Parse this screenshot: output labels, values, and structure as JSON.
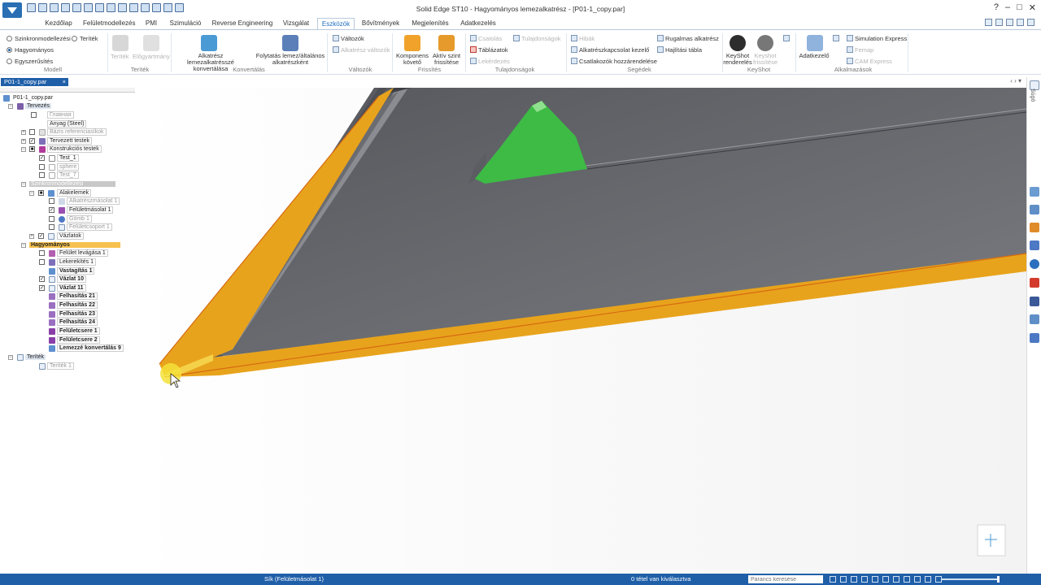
{
  "window": {
    "title": "Solid Edge ST10 - Hagyományos lemezalkatrész - [P01-1_copy.par]"
  },
  "tabs": [
    {
      "label": "Kezdőlap"
    },
    {
      "label": "Felületmodellezés"
    },
    {
      "label": "PMI"
    },
    {
      "label": "Szimuláció"
    },
    {
      "label": "Reverse Engineering"
    },
    {
      "label": "Vizsgálat"
    },
    {
      "label": "Eszközök",
      "active": true
    },
    {
      "label": "Bővítmények"
    },
    {
      "label": "Megjelenítés"
    },
    {
      "label": "Adatkezelés"
    }
  ],
  "ribbon": {
    "model": {
      "sync": "Szinkronmodellezési",
      "ordered": "Hagyományos",
      "simplify": "Egyszerűsítés",
      "label": "Modell"
    },
    "space": {
      "space_btn": "Teríték",
      "space_label": "Teríték",
      "preview": "Előgyártmány",
      "group_label": "Teríték"
    },
    "convert": {
      "to_sheetmetal": "Alkatrész lemezalkatrésszé konvertálása",
      "continue": "Folytatás lemez/általános alkatrészként",
      "label": "Konvertálás"
    },
    "variables": {
      "variables": "Változók",
      "part_variables": "Alkatrész változók",
      "label": "Változók"
    },
    "update": {
      "component_tracker": "Komponens követő",
      "active_level": "Aktív szint frissítése",
      "label": "Frissítés"
    },
    "properties": {
      "attach": "Csatolás",
      "properties": "Tulajdonságok",
      "tables": "Táblázatok",
      "query": "Lekérdezés",
      "label": "Tulajdonságok"
    },
    "assist": {
      "errors": "Hibák",
      "relation_mgr": "Alkatrészkapcsolat kezelő",
      "attach_connectors": "Csatlakozók hozzárendelése",
      "flex_part": "Rugalmas alkatrész",
      "bend_table": "Hajlítási tábla",
      "label": "Segédek"
    },
    "keyshot": {
      "render": "KeyShot renderelés",
      "update": "Keyshot frissítése",
      "label": "KeyShot"
    },
    "apps": {
      "data_manager": "Adatkezelő",
      "simulation_express": "Simulation Express",
      "femap": "Femap",
      "cam_express": "CAM Express",
      "label": "Alkalmazások"
    }
  },
  "document": {
    "tab": "P01-1_copy.par",
    "close": "×",
    "nav": "‹ › ▾"
  },
  "tree": {
    "root": "P01-1_copy.par",
    "design": "Tervezés",
    "main": "Главная",
    "material": "Anyag (Steel)",
    "base_refs": "Bázis referenciasíkok",
    "designed_bodies": "Tervezett testek",
    "construction_bodies": "Konstrukciós testek",
    "test1": "Test_1",
    "sphere": "sphere",
    "test7": "Test_7",
    "sync_modeling": "Szinkronmodellezési",
    "features": "Alakelemek",
    "part_copy": "Alkatrészmásolat 1",
    "surface_copy": "Felületmásolat 1",
    "sphere1": "Gömb 1",
    "surface_group": "Felületcsoport 1",
    "sketches": "Vázlatok",
    "ordered": "Hagyományos",
    "surface_trim": "Felület levágása 1",
    "round": "Lekerekítés 1",
    "thicken": "Vastagítás 1",
    "sketch10": "Vázlat 10",
    "sketch11": "Vázlat 11",
    "cut21": "Felhasítás 21",
    "cut22": "Felhasítás 22",
    "cut23": "Felhasítás 23",
    "cut24": "Felhasítás 24",
    "replace1": "Felületcsere 1",
    "replace2": "Felületcsere 2",
    "convert9": "Lemezzé konvertálás 9",
    "flat": "Teríték",
    "flat1": "Teríték 1"
  },
  "rail": {
    "label": "Súgó"
  },
  "status": {
    "message": "Sík (Felületmásolat 1)",
    "selection": "0 tétel van kiválasztva",
    "search_placeholder": "Parancs keresése"
  },
  "colors": {
    "accent": "#1f5fa8",
    "orange": "#e8a31c",
    "green": "#3dbb45",
    "body_gray": "#6b6d72"
  }
}
